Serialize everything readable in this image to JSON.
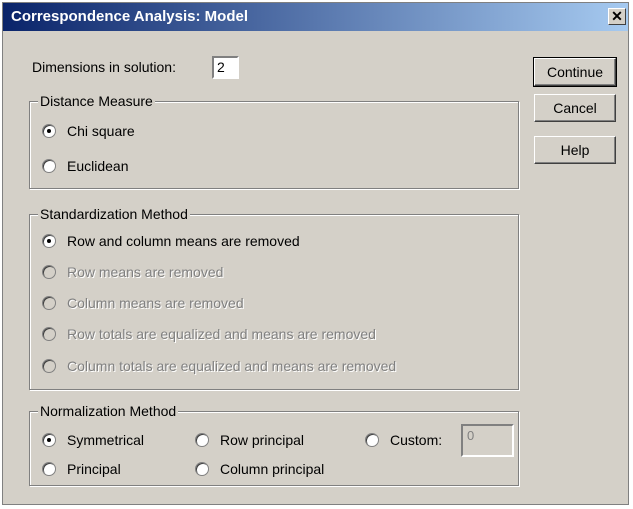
{
  "window": {
    "title": "Correspondence Analysis: Model",
    "close": "✕"
  },
  "dimensions": {
    "label": "Dimensions in solution:",
    "value": "2"
  },
  "buttons": {
    "continue": "Continue",
    "cancel": "Cancel",
    "help": "Help"
  },
  "distance": {
    "legend": "Distance Measure",
    "options": [
      {
        "label": "Chi square",
        "checked": true
      },
      {
        "label": "Euclidean",
        "checked": false
      }
    ]
  },
  "standardization": {
    "legend": "Standardization Method",
    "options": [
      {
        "label": "Row and column means are removed",
        "checked": true,
        "enabled": true
      },
      {
        "label": "Row means are removed",
        "checked": false,
        "enabled": false
      },
      {
        "label": "Column means are removed",
        "checked": false,
        "enabled": false
      },
      {
        "label": "Row totals are equalized and means are removed",
        "checked": false,
        "enabled": false
      },
      {
        "label": "Column totals are equalized and means are removed",
        "checked": false,
        "enabled": false
      }
    ]
  },
  "normalization": {
    "legend": "Normalization Method",
    "options": [
      {
        "label": "Symmetrical",
        "checked": true
      },
      {
        "label": "Row principal",
        "checked": false
      },
      {
        "label": "Custom:",
        "checked": false
      },
      {
        "label": "Principal",
        "checked": false
      },
      {
        "label": "Column principal",
        "checked": false
      }
    ],
    "custom_value": "0"
  }
}
